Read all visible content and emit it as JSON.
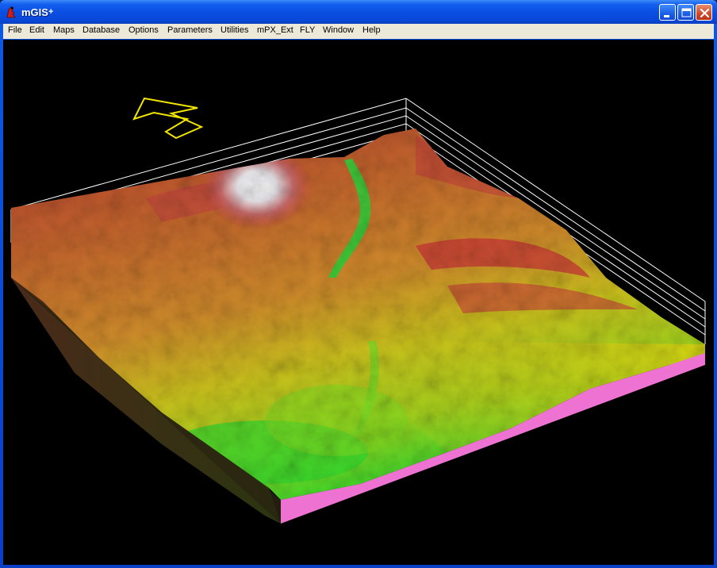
{
  "window": {
    "title": "mGIS",
    "title_badge": "+",
    "buttons": [
      "minimize",
      "maximize",
      "close"
    ]
  },
  "menu": [
    {
      "label": "File"
    },
    {
      "label": "Edit"
    },
    {
      "label": "Maps"
    },
    {
      "label": "Database"
    },
    {
      "label": "Options"
    },
    {
      "label": "Parameters"
    },
    {
      "label": "Utilities"
    },
    {
      "label": "mPX_Ext"
    },
    {
      "label": "FLY"
    },
    {
      "label": "Window"
    },
    {
      "label": "Help"
    }
  ],
  "view": {
    "background": "#000000",
    "north_arrow_color": "#f2e600",
    "bounding_box_color": "#ffffff",
    "base_side_color": "#f070d0",
    "elevation_colors": [
      "#1fd12a",
      "#c8d800",
      "#e9a61c",
      "#b8542e",
      "#c93838",
      "#ffffff"
    ]
  }
}
